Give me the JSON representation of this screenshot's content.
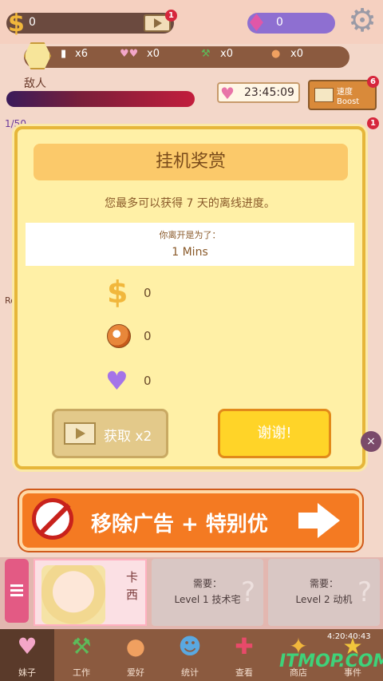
{
  "topbar": {
    "coins": "0",
    "coin_symbol": "$",
    "video_badge": "1",
    "gems": "0"
  },
  "resources": {
    "items": [
      {
        "icon": "bottle-icon",
        "count": "x6"
      },
      {
        "icon": "hearts-icon",
        "count": "x0"
      },
      {
        "icon": "shovel-icon",
        "count": "x0"
      },
      {
        "icon": "ball-icon",
        "count": "x0"
      }
    ]
  },
  "game": {
    "enemy_label": "敌人",
    "timer": "23:45:09",
    "boost_line1": "速度",
    "boost_line2": "Boost",
    "boost_badge": "6",
    "side_badge": "1",
    "love_count": "1/50",
    "side_letter": "Re"
  },
  "modal": {
    "title": "挂机奖赏",
    "subtitle": "您最多可以获得 7 天的离线进度。",
    "away_label": "你离开是为了：",
    "away_value": "1 Mins",
    "rewards": [
      {
        "icon": "coin-icon",
        "value": "0"
      },
      {
        "icon": "soccer-ball-icon",
        "value": "0"
      },
      {
        "icon": "purple-heart-icon",
        "value": "0"
      }
    ],
    "double_label": "获取 x2",
    "thanks_label": "谢谢!",
    "close_symbol": "×"
  },
  "ads": {
    "text": "移除广告 + 特别优"
  },
  "character": {
    "name": "卡西"
  },
  "slots": [
    {
      "need": "需要：",
      "level": "Level 1 技术宅",
      "mark": "?"
    },
    {
      "need": "需要：",
      "level": "Level 2 动机",
      "mark": "?"
    }
  ],
  "nav": {
    "items": [
      {
        "label": "妹子",
        "icon": "hearts-icon"
      },
      {
        "label": "工作",
        "icon": "shovel-icon"
      },
      {
        "label": "爱好",
        "icon": "ball-icon"
      },
      {
        "label": "统计",
        "icon": "person-icon"
      },
      {
        "label": "查看",
        "icon": "plus-icon"
      },
      {
        "label": "商店",
        "icon": "shop-icon"
      },
      {
        "label": "事件",
        "icon": "event-icon"
      }
    ],
    "time": "4:20:40:43",
    "watermark": "ITMOP.COM"
  }
}
